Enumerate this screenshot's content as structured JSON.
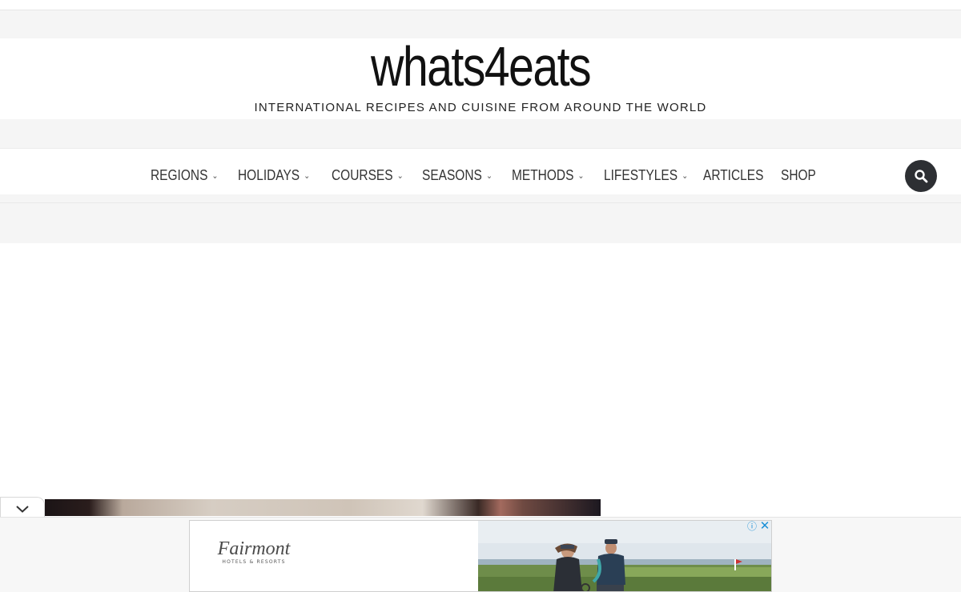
{
  "site": {
    "title": "whats4eats",
    "tagline": "INTERNATIONAL RECIPES AND CUISINE FROM AROUND THE WORLD"
  },
  "nav": {
    "items": [
      {
        "label": "REGIONS",
        "has_dropdown": true
      },
      {
        "label": "HOLIDAYS",
        "has_dropdown": true
      },
      {
        "label": "COURSES",
        "has_dropdown": true
      },
      {
        "label": "SEASONS",
        "has_dropdown": true
      },
      {
        "label": "METHODS",
        "has_dropdown": true
      },
      {
        "label": "LIFESTYLES",
        "has_dropdown": true
      },
      {
        "label": "ARTICLES",
        "has_dropdown": false
      },
      {
        "label": "SHOP",
        "has_dropdown": false
      }
    ],
    "dropdown_glyph": "⌄",
    "search_icon": "search-icon"
  },
  "ad": {
    "brand": "Fairmont",
    "brand_sub": "HOTELS & RESORTS",
    "info_glyph": "ⓘ",
    "close_glyph": "✕"
  },
  "colors": {
    "search_button": "#2d2f33",
    "ad_controls": "#1a8fd6",
    "band": "#f5f5f5"
  }
}
